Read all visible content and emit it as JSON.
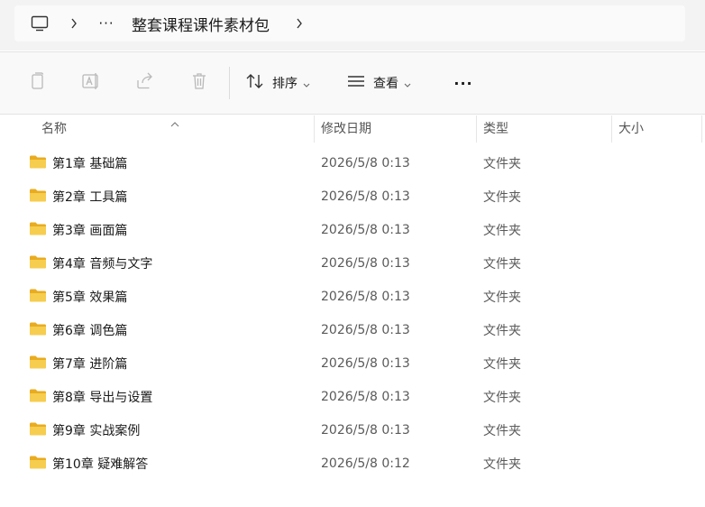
{
  "address": {
    "breadcrumb_sep": "›",
    "ellipsis": "···",
    "current_folder": "整套课程课件素材包"
  },
  "toolbar": {
    "sort_label": "排序",
    "view_label": "查看",
    "more_label": "···"
  },
  "columns": {
    "name": "名称",
    "modified": "修改日期",
    "type": "类型",
    "size": "大小"
  },
  "files": [
    {
      "name": "第1章 基础篇",
      "modified": "2026/5/8 0:13",
      "type": "文件夹",
      "size": ""
    },
    {
      "name": "第2章 工具篇",
      "modified": "2026/5/8 0:13",
      "type": "文件夹",
      "size": ""
    },
    {
      "name": "第3章 画面篇",
      "modified": "2026/5/8 0:13",
      "type": "文件夹",
      "size": ""
    },
    {
      "name": "第4章 音频与文字",
      "modified": "2026/5/8 0:13",
      "type": "文件夹",
      "size": ""
    },
    {
      "name": "第5章 效果篇",
      "modified": "2026/5/8 0:13",
      "type": "文件夹",
      "size": ""
    },
    {
      "name": "第6章 调色篇",
      "modified": "2026/5/8 0:13",
      "type": "文件夹",
      "size": ""
    },
    {
      "name": "第7章 进阶篇",
      "modified": "2026/5/8 0:13",
      "type": "文件夹",
      "size": ""
    },
    {
      "name": "第8章 导出与设置",
      "modified": "2026/5/8 0:13",
      "type": "文件夹",
      "size": ""
    },
    {
      "name": "第9章 实战案例",
      "modified": "2026/5/8 0:13",
      "type": "文件夹",
      "size": ""
    },
    {
      "name": "第10章 疑难解答",
      "modified": "2026/5/8 0:12",
      "type": "文件夹",
      "size": ""
    }
  ],
  "colors": {
    "folder": "#f4c542",
    "folder_dark": "#e6a817",
    "toolbar_bg": "#f9f9f9",
    "address_bg": "#f3f3f3"
  }
}
